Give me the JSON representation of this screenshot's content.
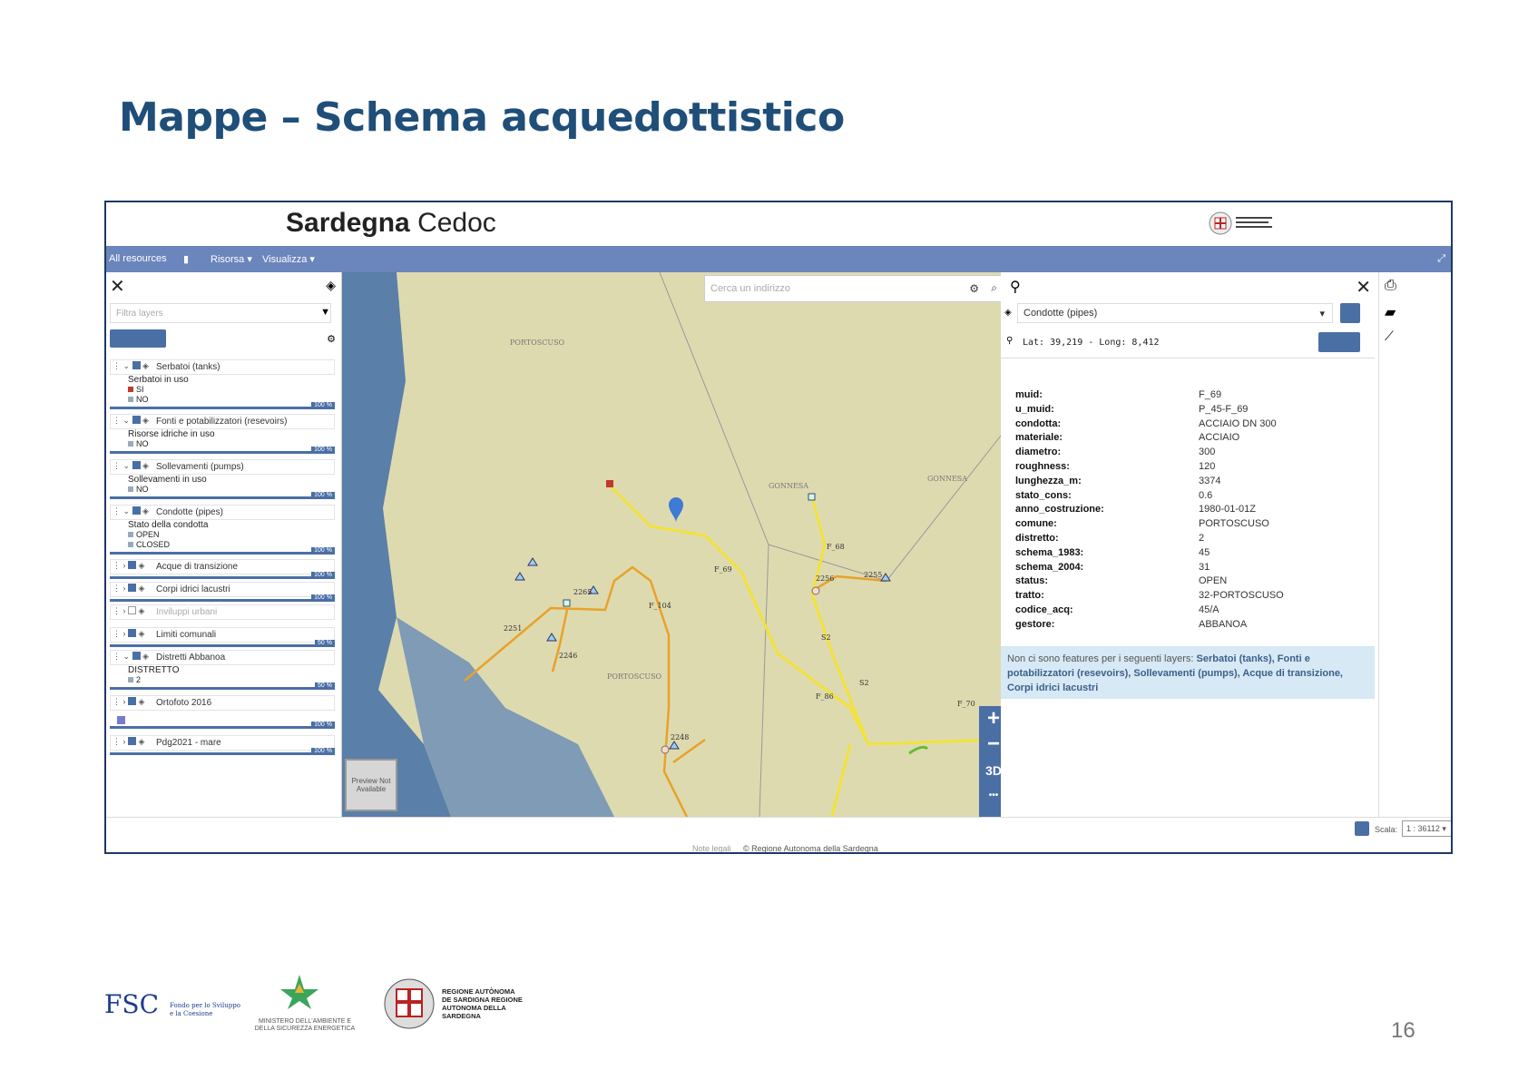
{
  "slide": {
    "title": "Mappe – Schema acquedottistico",
    "page_number": "16"
  },
  "header": {
    "brand_bold": "Sardegna",
    "brand_light": "Cedoc"
  },
  "nav": {
    "all_resources": "All resources",
    "risorsa": "Risorsa",
    "visualizza": "Visualizza"
  },
  "layers_panel": {
    "filter_placeholder": "Filtra layers",
    "layers": [
      {
        "name": "Serbatoi (tanks)",
        "legend_title": "Serbatoi in uso",
        "legend_items": [
          "SI",
          "NO"
        ],
        "opacity": "100 %"
      },
      {
        "name": "Fonti e potabilizzatori (resevoirs)",
        "legend_title": "Risorse idriche in uso",
        "legend_items": [
          "NO"
        ],
        "opacity": "100 %"
      },
      {
        "name": "Sollevamenti (pumps)",
        "legend_title": "Sollevamenti in uso",
        "legend_items": [
          "NO"
        ],
        "opacity": "100 %"
      },
      {
        "name": "Condotte (pipes)",
        "legend_title": "Stato della condotta",
        "legend_items": [
          "OPEN",
          "CLOSED"
        ],
        "opacity": "100 %"
      },
      {
        "name": "Acque di transizione",
        "opacity": "100 %"
      },
      {
        "name": "Corpi idrici lacustri",
        "opacity": "100 %"
      },
      {
        "name": "Inviluppi urbani"
      },
      {
        "name": "Limiti comunali",
        "opacity": "50 %"
      },
      {
        "name": "Distretti Abbanoa",
        "legend_title": "DISTRETTO",
        "legend_items": [
          "2"
        ],
        "opacity": "50 %"
      },
      {
        "name": "Ortofoto 2016",
        "opacity": "100 %"
      },
      {
        "name": "Pdg2021 - mare",
        "opacity": "100 %"
      }
    ]
  },
  "map": {
    "search_placeholder": "Cerca un indirizzo",
    "zoom_in": "+",
    "zoom_out": "−",
    "mode_3d": "3D",
    "more": "•••",
    "preview": "Preview Not Available",
    "place_labels": [
      "PORTOSCUSO",
      "GONNESA",
      "GONNESA",
      "PORTOSCUSO"
    ],
    "pipe_labels": [
      "F_69",
      "F_68",
      "2256",
      "2255",
      "2251",
      "2246",
      "F_104",
      "2248",
      "F_70",
      "2265",
      "F_86",
      "S2",
      "S2"
    ]
  },
  "info_panel": {
    "layer_select": "Condotte (pipes)",
    "coords": "Lat: 39,219 - Long: 8,412",
    "attributes": [
      {
        "key": "muid:",
        "value": "F_69"
      },
      {
        "key": "u_muid:",
        "value": "P_45-F_69"
      },
      {
        "key": "condotta:",
        "value": "ACCIAIO DN 300"
      },
      {
        "key": "materiale:",
        "value": "ACCIAIO"
      },
      {
        "key": "diametro:",
        "value": "300"
      },
      {
        "key": "roughness:",
        "value": "120"
      },
      {
        "key": "lunghezza_m:",
        "value": "3374"
      },
      {
        "key": "stato_cons:",
        "value": "0.6"
      },
      {
        "key": "anno_costruzione:",
        "value": "1980-01-01Z"
      },
      {
        "key": "comune:",
        "value": "PORTOSCUSO"
      },
      {
        "key": "distretto:",
        "value": "2"
      },
      {
        "key": "schema_1983:",
        "value": "45"
      },
      {
        "key": "schema_2004:",
        "value": "31"
      },
      {
        "key": "status:",
        "value": "OPEN"
      },
      {
        "key": "tratto:",
        "value": "32-PORTOSCUSO"
      },
      {
        "key": "codice_acq:",
        "value": "45/A"
      },
      {
        "key": "gestore:",
        "value": "ABBANOA"
      }
    ],
    "note_prefix": "Non ci sono features per i seguenti layers:",
    "note_layers": "Serbatoi (tanks), Fonti e potabilizzatori (resevoirs), Sollevamenti (pumps), Acque di transizione, Corpi idrici lacustri"
  },
  "footer": {
    "scale_label": "Scala:",
    "scale_value": "1 : 36112",
    "legal": "Note legali",
    "copyright": "© Regione Autonoma della Sardegna"
  },
  "logos": {
    "fsc": "FSC",
    "fsc_sub": "Fondo per lo Sviluppo e la Coesione",
    "ministry": "MINISTERO DELL'AMBIENTE E DELLA SICUREZZA ENERGETICA",
    "region": "REGIONE AUTÒNOMA DE SARDIGNA REGIONE AUTONOMA DELLA SARDEGNA"
  }
}
